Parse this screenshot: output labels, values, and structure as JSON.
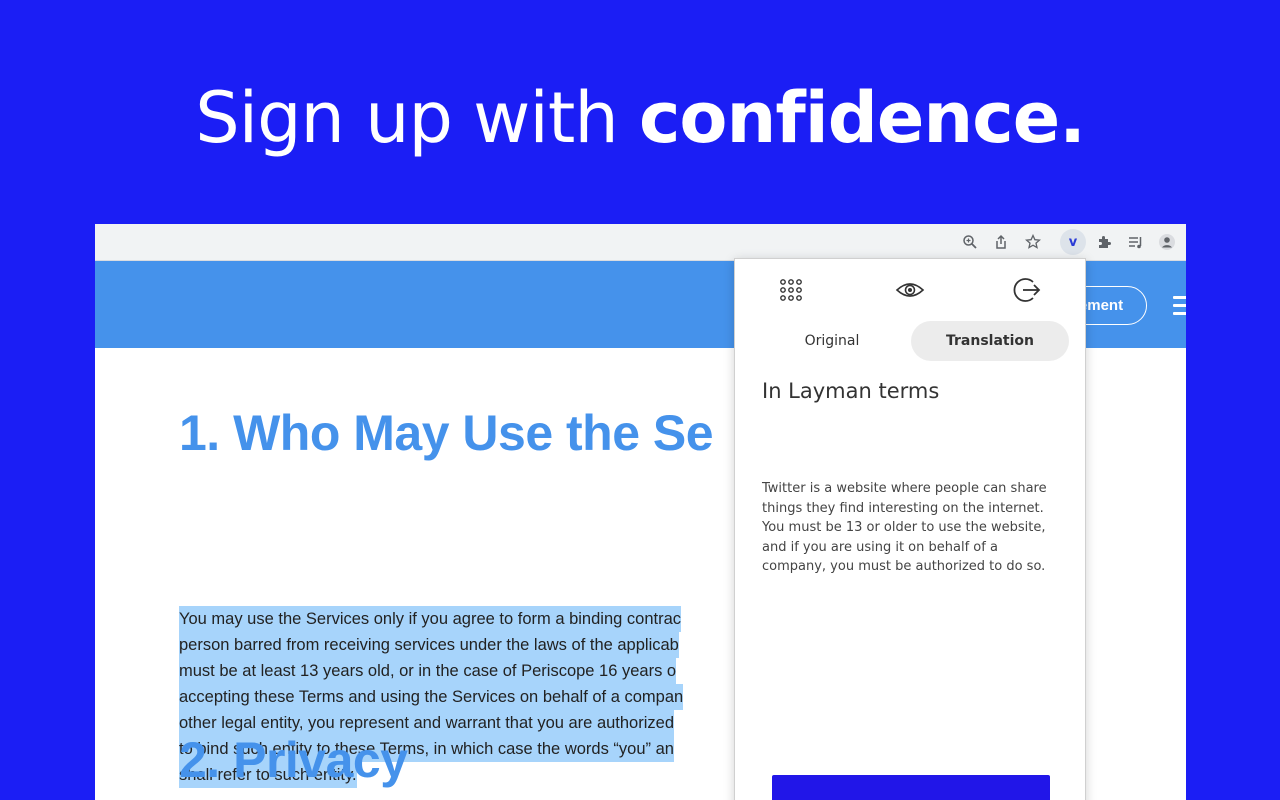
{
  "headline": {
    "light": "Sign up with ",
    "bold": "confidence."
  },
  "toolbar": {
    "icons": [
      "zoom-icon",
      "share-icon",
      "star-icon",
      "extension-logo-icon",
      "puzzle-icon",
      "media-queue-icon",
      "profile-icon"
    ],
    "extension_glyph": "ⅴ"
  },
  "site": {
    "header_button_label": "ement",
    "heading1": "1. Who May Use the Se",
    "paragraph_lines": [
      "You may use the Services only if you agree to form a binding contrac",
      "person barred from receiving services under the laws of the applicab",
      "must be at least 13 years old, or in the case of Periscope 16 years o",
      "accepting these Terms and using the Services on behalf of a compan",
      "other legal entity, you represent and warrant that you are authorized",
      "to bind such entity to these Terms, in which case the words “you” an",
      "shall refer to such entity."
    ],
    "heading2": "2. Privacy"
  },
  "popup": {
    "icons": [
      "grid-dots-icon",
      "eye-icon",
      "logout-icon"
    ],
    "tabs": [
      {
        "label": "Original",
        "active": false
      },
      {
        "label": "Translation",
        "active": true
      }
    ],
    "section_title": "In Layman terms",
    "translation_text": "Twitter is a website where people can share things they find interesting on the internet. You must be 13 or older to use the website, and if you are using it on behalf of a company, you must be authorized to do so.",
    "accent_color": "#2116e8"
  },
  "colors": {
    "background": "#1b1ef5",
    "site_blue": "#4592eb",
    "highlight": "#a7d4fb"
  }
}
